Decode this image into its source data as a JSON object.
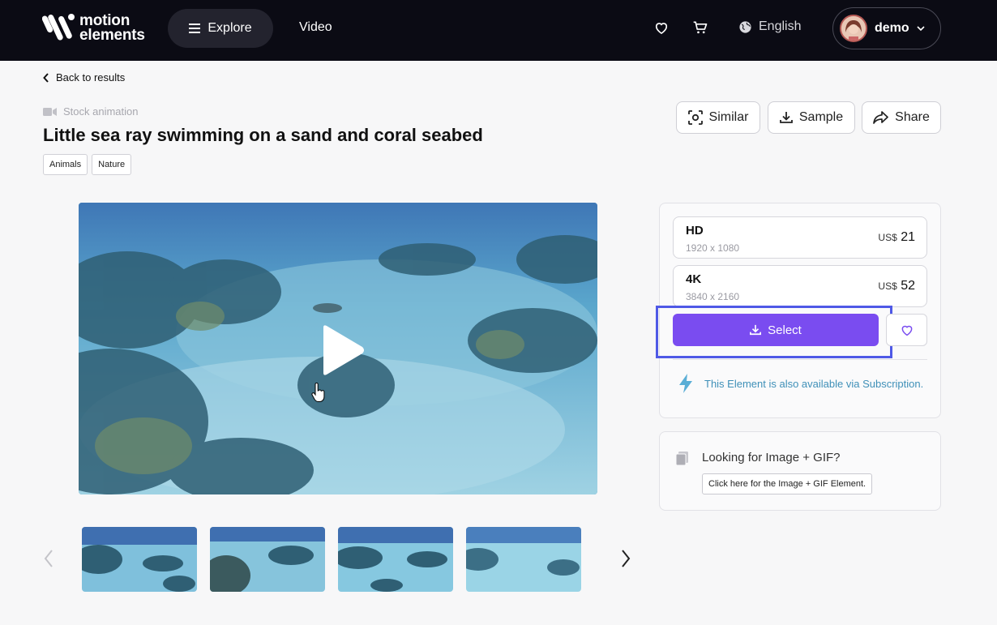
{
  "header": {
    "logo_line1": "motion",
    "logo_line2": "elements",
    "explore_label": "Explore",
    "video_label": "Video",
    "language_label": "English",
    "user_label": "demo"
  },
  "breadcrumb": {
    "back_label": "Back to results"
  },
  "item": {
    "kind_label": "Stock animation",
    "title": "Little sea ray swimming on a sand and coral seabed",
    "tags": [
      "Animals",
      "Nature"
    ]
  },
  "actions": {
    "similar_label": "Similar",
    "sample_label": "Sample",
    "share_label": "Share"
  },
  "options": [
    {
      "name": "HD",
      "resolution": "1920 x 1080",
      "currency": "US$",
      "price": "21"
    },
    {
      "name": "4K",
      "resolution": "3840 x 2160",
      "currency": "US$",
      "price": "52"
    }
  ],
  "purchase": {
    "select_label": "Select",
    "subscription_note": "This Element is also available via Subscription."
  },
  "gif_panel": {
    "title": "Looking for Image + GIF?",
    "link_label": "Click here for the Image + GIF Element."
  },
  "colors": {
    "header_bg": "#0b0b14",
    "select_button": "#7a4cf0",
    "highlight_border": "#4f59e6",
    "subscription_text": "#3f90b8"
  }
}
